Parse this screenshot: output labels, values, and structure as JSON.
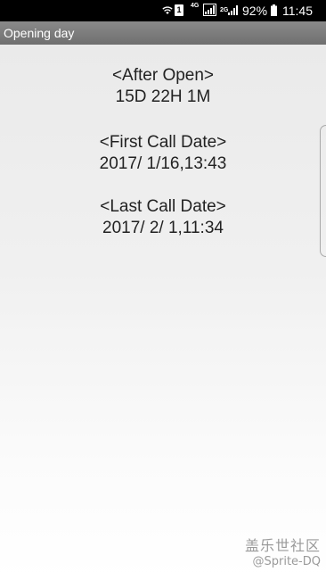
{
  "status_bar": {
    "sim_badge": "1",
    "network_4g": "4G",
    "network_2g": "2G",
    "battery_percent": "92%",
    "time": "11:45"
  },
  "app_bar": {
    "title": "Opening day"
  },
  "after_open": {
    "label": "<After Open>",
    "value": "15D 22H 1M"
  },
  "first_call": {
    "label": "<First Call Date>",
    "value": "2017/ 1/16,13:43"
  },
  "last_call": {
    "label": "<Last Call Date>",
    "value": "2017/ 2/ 1,11:34"
  },
  "watermark": {
    "community": "盖乐世社区",
    "author": "@Sprite-DQ"
  },
  "icons": {
    "wifi": "wifi-icon",
    "signal": "signal-icon",
    "battery": "battery-icon"
  }
}
